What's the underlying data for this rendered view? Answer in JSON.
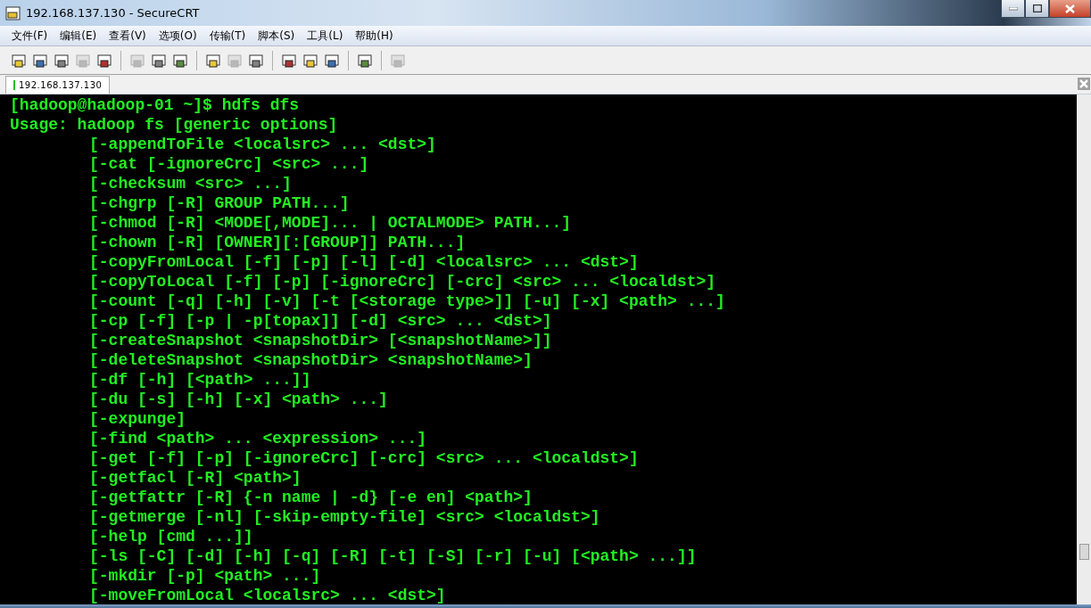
{
  "window": {
    "title": "192.168.137.130 - SecureCRT"
  },
  "menu": [
    "文件(F)",
    "编辑(E)",
    "查看(V)",
    "选项(O)",
    "传输(T)",
    "脚本(S)",
    "工具(L)",
    "帮助(H)"
  ],
  "toolbar": [
    {
      "kind": "icon",
      "disabled": false
    },
    {
      "kind": "icon",
      "disabled": false
    },
    {
      "kind": "icon",
      "disabled": false
    },
    {
      "kind": "icon",
      "disabled": true
    },
    {
      "kind": "icon",
      "disabled": false
    },
    {
      "kind": "separator"
    },
    {
      "kind": "icon",
      "disabled": true
    },
    {
      "kind": "icon",
      "disabled": false
    },
    {
      "kind": "icon",
      "disabled": false
    },
    {
      "kind": "separator"
    },
    {
      "kind": "icon",
      "disabled": false
    },
    {
      "kind": "icon",
      "disabled": true
    },
    {
      "kind": "icon",
      "disabled": false
    },
    {
      "kind": "separator"
    },
    {
      "kind": "icon",
      "disabled": false
    },
    {
      "kind": "icon",
      "disabled": false
    },
    {
      "kind": "icon",
      "disabled": false
    },
    {
      "kind": "separator"
    },
    {
      "kind": "icon",
      "disabled": false
    },
    {
      "kind": "separator"
    },
    {
      "kind": "icon",
      "disabled": true
    }
  ],
  "tabs": [
    {
      "label": "192.168.137.130",
      "selected": true,
      "connected": true
    }
  ],
  "terminal": {
    "lines": [
      {
        "text": "[hadoop@hadoop-01 ~]$ hdfs dfs",
        "kind": "prompt"
      },
      {
        "text": "Usage: hadoop fs [generic options]",
        "kind": "output"
      },
      {
        "text": "[-appendToFile <localsrc> ... <dst>]",
        "kind": "option"
      },
      {
        "text": "[-cat [-ignoreCrc] <src> ...]",
        "kind": "option"
      },
      {
        "text": "[-checksum <src> ...]",
        "kind": "option"
      },
      {
        "text": "[-chgrp [-R] GROUP PATH...]",
        "kind": "option"
      },
      {
        "text": "[-chmod [-R] <MODE[,MODE]... | OCTALMODE> PATH...]",
        "kind": "option"
      },
      {
        "text": "[-chown [-R] [OWNER][:[GROUP]] PATH...]",
        "kind": "option"
      },
      {
        "text": "[-copyFromLocal [-f] [-p] [-l] [-d] <localsrc> ... <dst>]",
        "kind": "option"
      },
      {
        "text": "[-copyToLocal [-f] [-p] [-ignoreCrc] [-crc] <src> ... <localdst>]",
        "kind": "option"
      },
      {
        "text": "[-count [-q] [-h] [-v] [-t [<storage type>]] [-u] [-x] <path> ...]",
        "kind": "option"
      },
      {
        "text": "[-cp [-f] [-p | -p[topax]] [-d] <src> ... <dst>]",
        "kind": "option"
      },
      {
        "text": "[-createSnapshot <snapshotDir> [<snapshotName>]]",
        "kind": "option"
      },
      {
        "text": "[-deleteSnapshot <snapshotDir> <snapshotName>]",
        "kind": "option"
      },
      {
        "text": "[-df [-h] [<path> ...]]",
        "kind": "option"
      },
      {
        "text": "[-du [-s] [-h] [-x] <path> ...]",
        "kind": "option"
      },
      {
        "text": "[-expunge]",
        "kind": "option"
      },
      {
        "text": "[-find <path> ... <expression> ...]",
        "kind": "option"
      },
      {
        "text": "[-get [-f] [-p] [-ignoreCrc] [-crc] <src> ... <localdst>]",
        "kind": "option"
      },
      {
        "text": "[-getfacl [-R] <path>]",
        "kind": "option"
      },
      {
        "text": "[-getfattr [-R] {-n name | -d} [-e en] <path>]",
        "kind": "option"
      },
      {
        "text": "[-getmerge [-nl] [-skip-empty-file] <src> <localdst>]",
        "kind": "option"
      },
      {
        "text": "[-help [cmd ...]]",
        "kind": "option"
      },
      {
        "text": "[-ls [-C] [-d] [-h] [-q] [-R] [-t] [-S] [-r] [-u] [<path> ...]]",
        "kind": "option"
      },
      {
        "text": "[-mkdir [-p] <path> ...]",
        "kind": "option"
      },
      {
        "text": "[-moveFromLocal <localsrc> ... <dst>]",
        "kind": "option"
      }
    ]
  }
}
